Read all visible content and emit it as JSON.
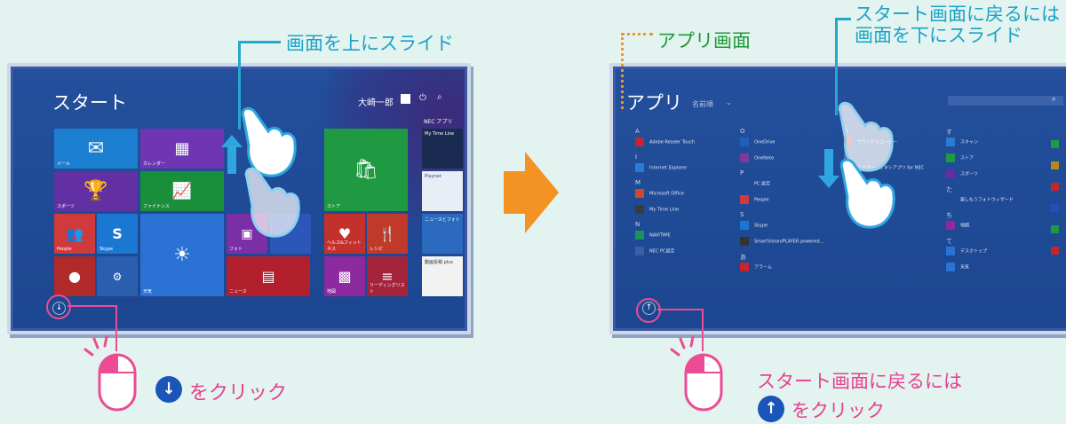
{
  "left_screen": {
    "title": "スタート",
    "user_name": "大崎一郎",
    "nec_apps_label": "NEC アプリ",
    "tiles": [
      {
        "label": "メール",
        "icon": "mail-icon",
        "color": "#1c7fd1"
      },
      {
        "label": "カレンダー",
        "icon": "calendar-icon",
        "color": "#6f36b3"
      },
      {
        "label": "スポーツ",
        "icon": "trophy-icon",
        "color": "#6230a3"
      },
      {
        "label": "ファイナンス",
        "icon": "finance-icon",
        "color": "#198f3c"
      },
      {
        "label": "People",
        "icon": "people-icon",
        "color": "#d13a3a"
      },
      {
        "label": "Skype",
        "icon": "skype-icon",
        "color": "#1a78d3"
      },
      {
        "label": "天気",
        "icon": "sun-icon",
        "color": "#2a73d4"
      },
      {
        "label": "フォト",
        "icon": "photo-icon",
        "color": "#7a2fa6"
      },
      {
        "label": "ヘルス&フィットネス",
        "icon": "heart-icon",
        "color": "#c4302b"
      },
      {
        "label": "レシピ",
        "icon": "recipe-icon",
        "color": "#c03a2b"
      },
      {
        "label": "ストア",
        "icon": "store-icon",
        "color": "#1f9a43"
      },
      {
        "label": "ニュース",
        "icon": "news-icon",
        "color": "#b21f2d"
      },
      {
        "label": "地図",
        "icon": "map-icon",
        "color": "#8d2aa0"
      },
      {
        "label": "リーディングリスト",
        "icon": "list-icon",
        "color": "#a4243b"
      }
    ],
    "nec_tiles": [
      "My Time Line",
      "Playnet",
      "ニュースとフォト",
      "動画投稿 plus"
    ]
  },
  "right_screen": {
    "title": "アプリ",
    "sort_label": "名前順",
    "columns": [
      [
        {
          "type": "letter",
          "text": "A"
        },
        {
          "type": "app",
          "text": "Adobe Reader Touch",
          "color": "#c4262e"
        },
        {
          "type": "letter",
          "text": "I"
        },
        {
          "type": "app",
          "text": "Internet Explorer",
          "color": "#2a7ad6"
        },
        {
          "type": "letter",
          "text": "M"
        },
        {
          "type": "app",
          "text": "Microsoft Office",
          "color": "#d24726"
        },
        {
          "type": "app",
          "text": "My Time Line",
          "color": "#3b3b3b"
        },
        {
          "type": "letter",
          "text": "N"
        },
        {
          "type": "app",
          "text": "NAVITIME",
          "color": "#18955a"
        },
        {
          "type": "app",
          "text": "NEC PC設定",
          "color": "#3d5da4"
        }
      ],
      [
        {
          "type": "letter",
          "text": "O"
        },
        {
          "type": "app",
          "text": "OneDrive",
          "color": "#1f5fbd"
        },
        {
          "type": "app",
          "text": "OneNote",
          "color": "#7e3a9e"
        },
        {
          "type": "letter",
          "text": "P"
        },
        {
          "type": "app",
          "text": "PC 設定",
          "color": "#1f4a93"
        },
        {
          "type": "app",
          "text": "People",
          "color": "#d13a3a"
        },
        {
          "type": "letter",
          "text": "S"
        },
        {
          "type": "app",
          "text": "Skype",
          "color": "#1a78d3"
        },
        {
          "type": "app",
          "text": "SmartVision/PLAYER powered…",
          "color": "#333333"
        },
        {
          "type": "letter",
          "text": "あ"
        },
        {
          "type": "app",
          "text": "アラーム",
          "color": "#c4262e"
        }
      ],
      [
        {
          "type": "letter",
          "text": "さ"
        },
        {
          "type": "app",
          "text": "サウンドレコーダー",
          "color": "#c4262e"
        },
        {
          "type": "letter",
          "text": "し"
        },
        {
          "type": "app",
          "text": "シェアー・オタシアプリ for NEC",
          "color": "#c4262e"
        }
      ],
      [
        {
          "type": "letter",
          "text": "す"
        },
        {
          "type": "app",
          "text": "スキャン",
          "color": "#2a7ad6"
        },
        {
          "type": "app",
          "text": "ストア",
          "color": "#1f9a43"
        },
        {
          "type": "app",
          "text": "スポーツ",
          "color": "#6230a3"
        },
        {
          "type": "letter",
          "text": "た"
        },
        {
          "type": "app",
          "text": "楽しもうフォトウィザード",
          "color": "#1f4a93"
        },
        {
          "type": "letter",
          "text": "ち"
        },
        {
          "type": "app",
          "text": "地図",
          "color": "#8d2aa0"
        },
        {
          "type": "letter",
          "text": "て"
        },
        {
          "type": "app",
          "text": "デスクトップ",
          "color": "#2a73d4"
        },
        {
          "type": "app",
          "text": "天気",
          "color": "#2a73d4"
        }
      ]
    ]
  },
  "annotations": {
    "slide_up": "画面を上にスライド",
    "app_screen_label": "アプリ画面",
    "back_to_start_line1": "スタート画面に戻るには",
    "back_to_start_line2": "画面を下にスライド",
    "click_down": "をクリック",
    "back_click_line1": "スタート画面に戻るには",
    "back_click_line2": "をクリック"
  }
}
